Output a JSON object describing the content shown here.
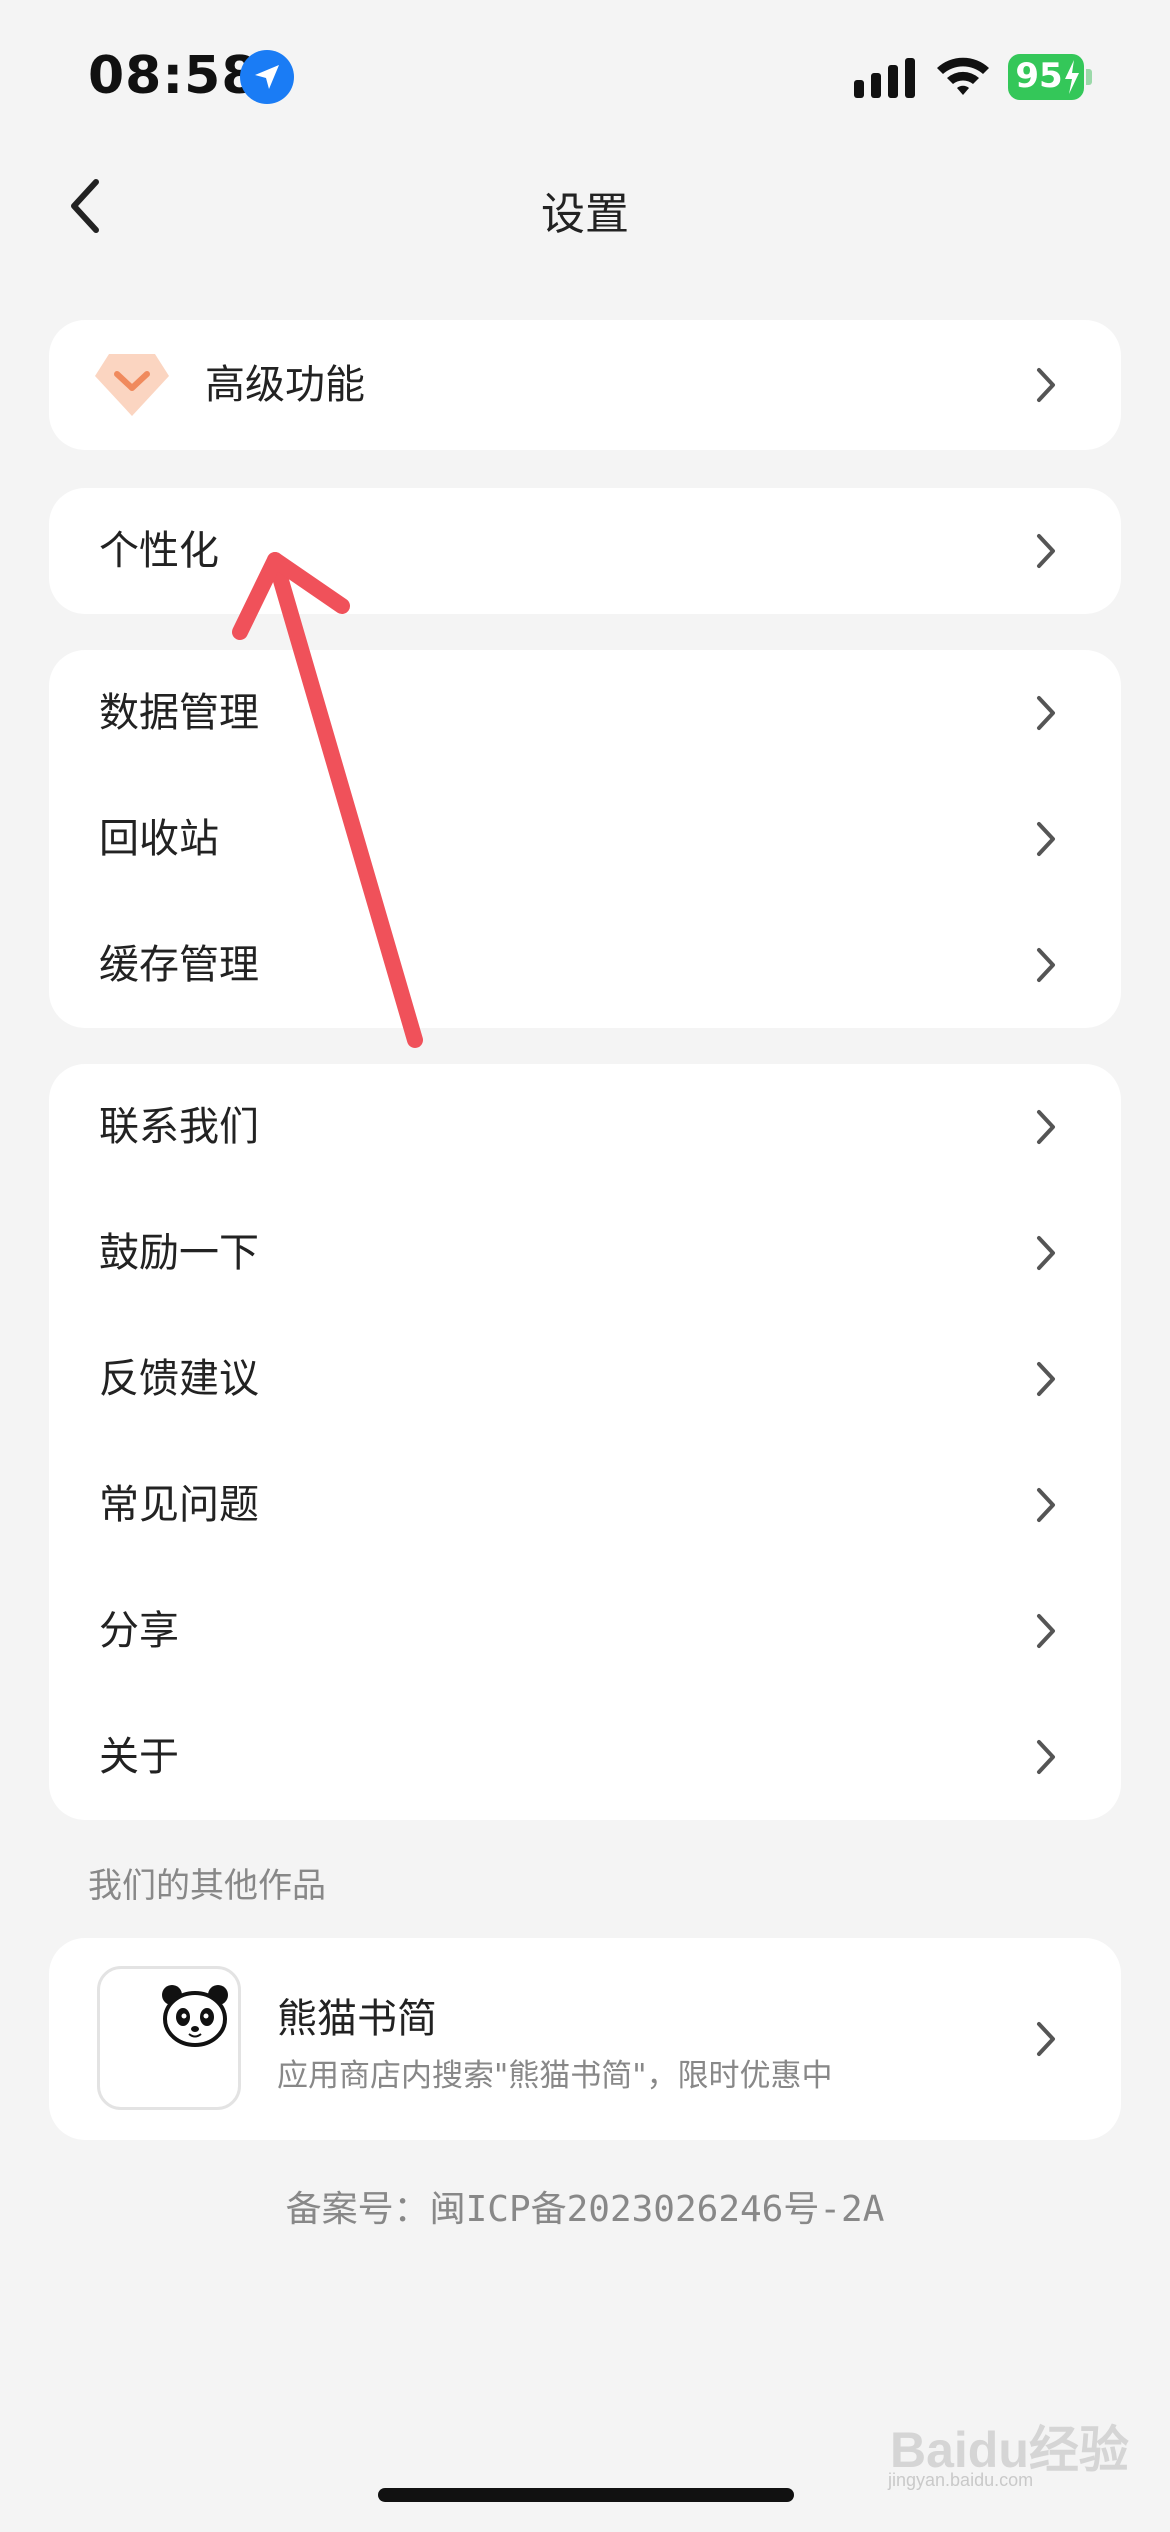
{
  "status": {
    "time": "08:58",
    "battery": "95"
  },
  "header": {
    "title": "设置"
  },
  "premium": {
    "label": "高级功能"
  },
  "personal": {
    "label": "个性化"
  },
  "data_group": {
    "items": [
      "数据管理",
      "回收站",
      "缓存管理"
    ]
  },
  "support_group": {
    "items": [
      "联系我们",
      "鼓励一下",
      "反馈建议",
      "常见问题",
      "分享",
      "关于"
    ]
  },
  "other_works": {
    "section_title": "我们的其他作品",
    "app_name": "熊猫书简",
    "app_desc": "应用商店内搜索\"熊猫书简\"，限时优惠中"
  },
  "footer": {
    "icp": "备案号：闽ICP备2023026246号-2A"
  },
  "watermark": {
    "text": "Baidu经验",
    "sub": "jingyan.baidu.com"
  },
  "colors": {
    "accent_arrow": "#f0515a",
    "premium_icon": "#f6a27a",
    "battery": "#34c759",
    "location": "#1a7cf5"
  }
}
